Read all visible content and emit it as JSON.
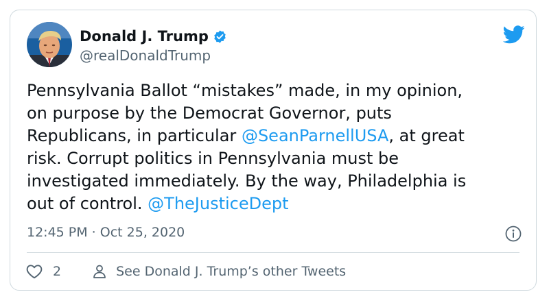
{
  "author": {
    "display_name": "Donald J. Trump",
    "handle": "@realDonaldTrump",
    "verified": true
  },
  "tweet": {
    "lines": [
      [
        {
          "text": "Pennsylvania Ballot “mistakes” made, in my opinion,",
          "type": "text"
        }
      ],
      [
        {
          "text": "on purpose by the Democrat Governor, puts",
          "type": "text"
        }
      ],
      [
        {
          "text": "Republicans, in particular ",
          "type": "text"
        },
        {
          "text": "@SeanParnellUSA",
          "type": "mention"
        },
        {
          "text": ", at great",
          "type": "text"
        }
      ],
      [
        {
          "text": "risk. Corrupt politics in Pennsylvania must be",
          "type": "text"
        }
      ],
      [
        {
          "text": "investigated immediately. By the way, Philadelphia is",
          "type": "text"
        }
      ],
      [
        {
          "text": "out of control. ",
          "type": "text"
        },
        {
          "text": "@TheJusticeDept",
          "type": "mention"
        }
      ]
    ],
    "timestamp": "12:45 PM · Oct 25, 2020"
  },
  "footer": {
    "like_count": "2",
    "other_tweets_label": "See Donald J. Trump’s other Tweets"
  },
  "icons": {
    "brand": "twitter-bird-icon",
    "verified": "verified-badge-icon",
    "info": "info-icon",
    "like": "heart-icon",
    "profile": "person-icon"
  },
  "colors": {
    "accent": "#1d9bf0",
    "text": "#0f1419",
    "secondary": "#536471",
    "border": "#cfd9de"
  }
}
